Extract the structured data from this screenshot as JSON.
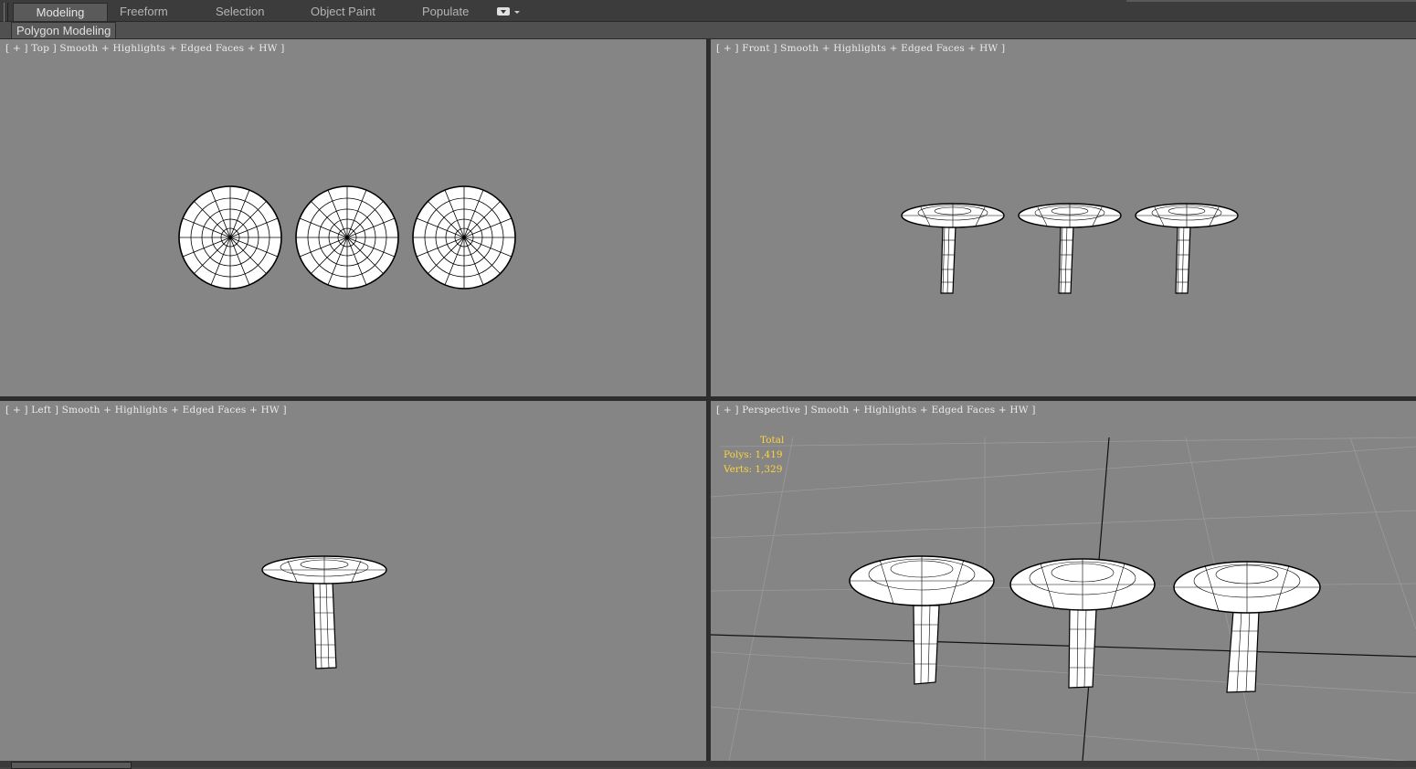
{
  "ribbon": {
    "tabs": [
      {
        "label": "Modeling",
        "active": true
      },
      {
        "label": "Freeform",
        "active": false
      },
      {
        "label": "Selection",
        "active": false
      },
      {
        "label": "Object Paint",
        "active": false
      },
      {
        "label": "Populate",
        "active": false
      }
    ],
    "subpanel_label": "Polygon Modeling"
  },
  "viewports": {
    "top": {
      "label": "[ + ] Top ] Smooth + Highlights + Edged Faces + HW ]"
    },
    "front": {
      "label": "[ + ] Front ] Smooth + Highlights + Edged Faces + HW ]"
    },
    "left": {
      "label": "[ + ] Left ] Smooth + Highlights + Edged Faces + HW ]"
    },
    "perspective": {
      "label": "[ + ] Perspective ] Smooth + Highlights + Edged Faces + HW ]",
      "stats": {
        "total_label": "Total",
        "polys": "Polys: 1,419",
        "verts": "Verts: 1,329"
      }
    }
  },
  "colors": {
    "viewport_bg": "#858585",
    "stats_text": "#ffd23a",
    "mesh_fill": "#ffffff",
    "mesh_wire": "#000000"
  },
  "icons": [
    "viewport-settings-dropdown-icon"
  ]
}
